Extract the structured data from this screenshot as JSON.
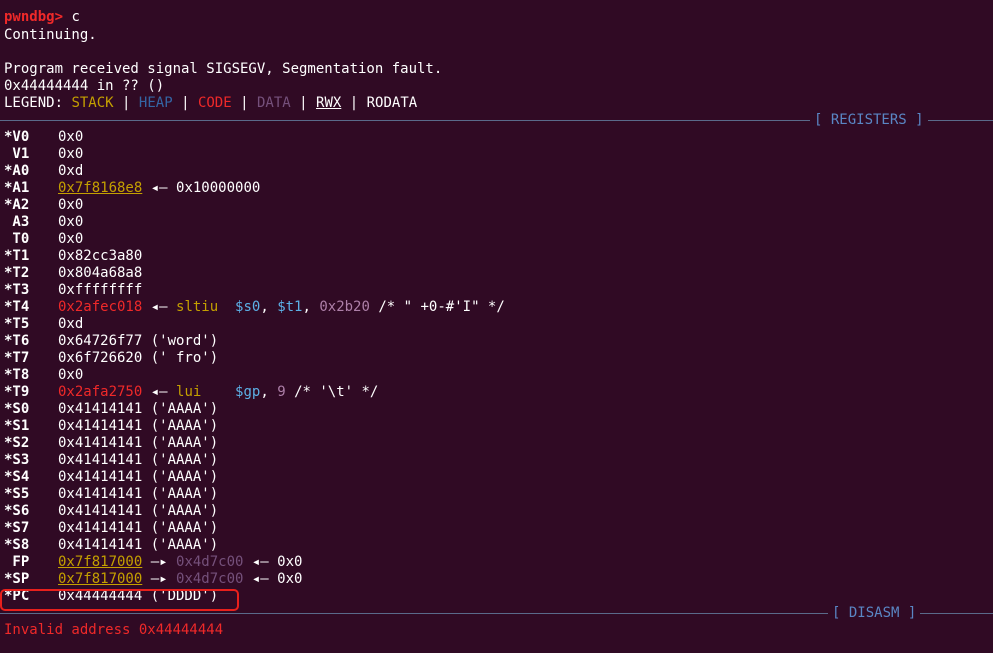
{
  "terminal": {
    "prompt": "pwndbg>",
    "command": "c",
    "continuing": "Continuing.",
    "signal_msg": "Program received signal SIGSEGV, Segmentation fault.",
    "location": "0x44444444 in ?? ()",
    "legend": {
      "label": "LEGEND:",
      "stack": "STACK",
      "heap": "HEAP",
      "code": "CODE",
      "data": "DATA",
      "rwx": "RWX",
      "rodata": "RODATA",
      "sep": "|"
    },
    "registers_header": "[ REGISTERS ]",
    "disasm_header": "[ DISASM ]",
    "error": "Invalid address 0x44444444",
    "registers": [
      {
        "name": "*V0",
        "value": "0x0"
      },
      {
        "name": " V1",
        "value": "0x0"
      },
      {
        "name": "*A0",
        "value": "0xd"
      },
      {
        "name": "*A1",
        "ptr": "0x7f8168e8",
        "arrow": " ◂— ",
        "rest": "0x10000000"
      },
      {
        "name": "*A2",
        "value": "0x0"
      },
      {
        "name": " A3",
        "value": "0x0"
      },
      {
        "name": " T0",
        "value": "0x0"
      },
      {
        "name": "*T1",
        "value": "0x82cc3a80"
      },
      {
        "name": "*T2",
        "value": "0x804a68a8"
      },
      {
        "name": "*T3",
        "value": "0xffffffff"
      },
      {
        "name": "*T4",
        "code_ptr": "0x2afec018",
        "arrow": " ◂— ",
        "mnemonic": "sltiu",
        "op1": "$s0",
        "op2": "$t1",
        "op3": "0x2b20",
        "comment": "/* \" +0-#'I\" */"
      },
      {
        "name": "*T5",
        "value": "0xd"
      },
      {
        "name": "*T6",
        "value": "0x64726f77 ('word')"
      },
      {
        "name": "*T7",
        "value": "0x6f726620 (' fro')"
      },
      {
        "name": "*T8",
        "value": "0x0"
      },
      {
        "name": "*T9",
        "code_ptr": "0x2afa2750",
        "arrow": " ◂— ",
        "mnemonic": "lui",
        "op1": "$gp",
        "op3": "9",
        "comment": "/* '\\t' */"
      },
      {
        "name": "*S0",
        "value": "0x41414141 ('AAAA')"
      },
      {
        "name": "*S1",
        "value": "0x41414141 ('AAAA')"
      },
      {
        "name": "*S2",
        "value": "0x41414141 ('AAAA')"
      },
      {
        "name": "*S3",
        "value": "0x41414141 ('AAAA')"
      },
      {
        "name": "*S4",
        "value": "0x41414141 ('AAAA')"
      },
      {
        "name": "*S5",
        "value": "0x41414141 ('AAAA')"
      },
      {
        "name": "*S6",
        "value": "0x41414141 ('AAAA')"
      },
      {
        "name": "*S7",
        "value": "0x41414141 ('AAAA')"
      },
      {
        "name": "*S8",
        "value": "0x41414141 ('AAAA')"
      },
      {
        "name": " FP",
        "ptr": "0x7f817000",
        "arrow2": " —▸ ",
        "mid": "0x4d7c00",
        "arrow": " ◂— ",
        "rest": "0x0"
      },
      {
        "name": "*SP",
        "ptr": "0x7f817000",
        "arrow2": " —▸ ",
        "mid": "0x4d7c00",
        "arrow": " ◂— ",
        "rest": "0x0"
      },
      {
        "name": "*PC",
        "value": "0x44444444 ('DDDD')"
      }
    ]
  },
  "colors": {
    "background": "#300a24",
    "prompt": "#ef2929",
    "stack": "#c4a000",
    "heap": "#3465a4",
    "code": "#ef2929",
    "data": "#75507b",
    "highlight_box": "#e8201c"
  }
}
